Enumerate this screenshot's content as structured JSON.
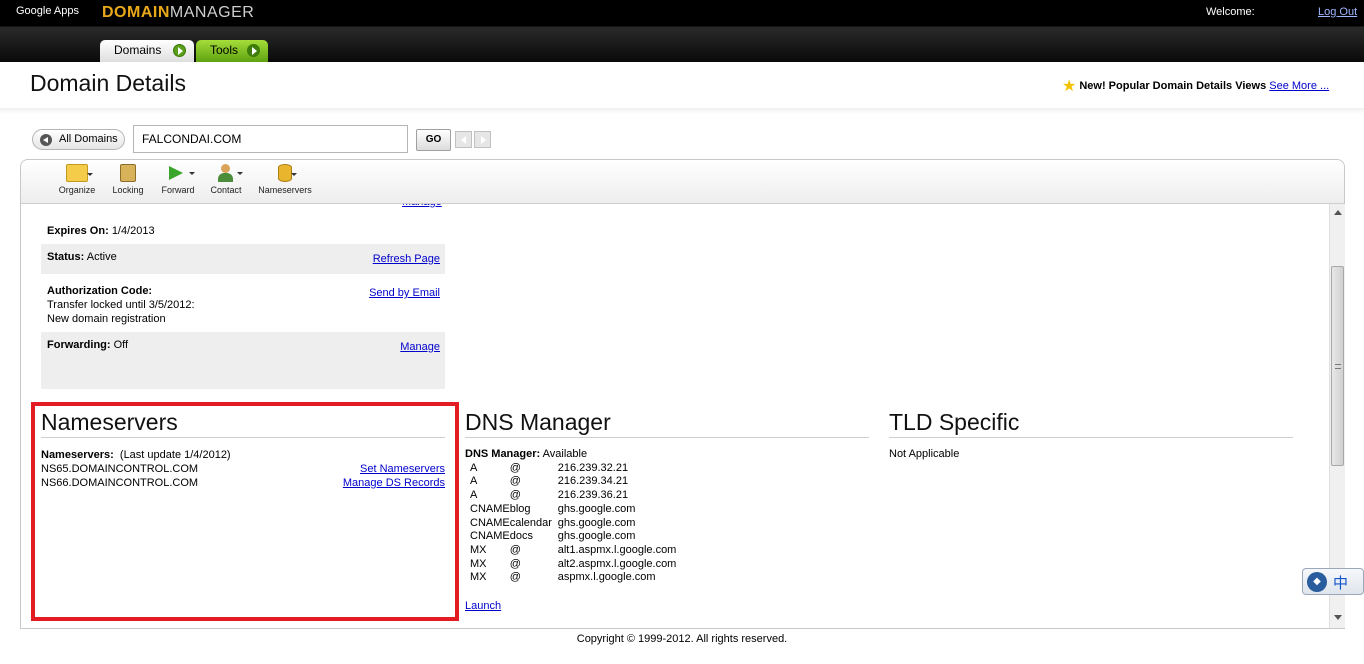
{
  "header": {
    "google_apps": "Google Apps",
    "logo_part1": "DOMAIN",
    "logo_part2": "MANAGER",
    "welcome": "Welcome:",
    "logout": "Log Out"
  },
  "tabs": [
    {
      "label": "Domains"
    },
    {
      "label": "Tools"
    }
  ],
  "page": {
    "title": "Domain Details",
    "promo_text": "New! Popular Domain Details Views",
    "promo_link": "See More ..."
  },
  "search": {
    "all_domains": "All Domains",
    "domain_value": "FALCONDAI.COM",
    "go": "GO"
  },
  "toolbar": [
    {
      "label": "Organize",
      "icon": "folder-icon"
    },
    {
      "label": "Locking",
      "icon": "lock-icon"
    },
    {
      "label": "Forward",
      "icon": "forward-arrow-icon"
    },
    {
      "label": "Contact",
      "icon": "contact-person-icon"
    },
    {
      "label": "Nameservers",
      "icon": "database-icon"
    }
  ],
  "details": {
    "expires_label": "Expires On:",
    "expires_value": "1/4/2013",
    "status_label": "Status:",
    "status_value": "Active",
    "status_action": "Refresh Page",
    "auth_label": "Authorization Code:",
    "auth_line1": "Transfer locked until 3/5/2012:",
    "auth_line2": "New domain registration",
    "auth_action": "Send by Email",
    "forwarding_label": "Forwarding:",
    "forwarding_value": "Off",
    "forwarding_action": "Manage"
  },
  "nameservers": {
    "title": "Nameservers",
    "label": "Nameservers:",
    "last_update": "(Last update 1/4/2012)",
    "ns1": "NS65.DOMAINCONTROL.COM",
    "ns2": "NS66.DOMAINCONTROL.COM",
    "set_action": "Set Nameservers",
    "ds_action": "Manage DS Records"
  },
  "dns": {
    "title": "DNS Manager",
    "label": "DNS Manager:",
    "status": "Available",
    "records": [
      {
        "type": "A",
        "host": "@",
        "value": "216.239.32.21"
      },
      {
        "type": "A",
        "host": "@",
        "value": "216.239.34.21"
      },
      {
        "type": "A",
        "host": "@",
        "value": "216.239.36.21"
      },
      {
        "type": "CNAME",
        "host": "blog",
        "value": "ghs.google.com"
      },
      {
        "type": "CNAME",
        "host": "calendar",
        "value": "ghs.google.com"
      },
      {
        "type": "CNAME",
        "host": "docs",
        "value": "ghs.google.com"
      },
      {
        "type": "MX",
        "host": "@",
        "value": "alt1.aspmx.l.google.com"
      },
      {
        "type": "MX",
        "host": "@",
        "value": "alt2.aspmx.l.google.com"
      },
      {
        "type": "MX",
        "host": "@",
        "value": "aspmx.l.google.com"
      }
    ],
    "launch": "Launch"
  },
  "tld": {
    "title": "TLD Specific",
    "value": "Not Applicable"
  },
  "ime": {
    "label": "中"
  },
  "footer": "Copyright © 1999-2012. All rights reserved."
}
